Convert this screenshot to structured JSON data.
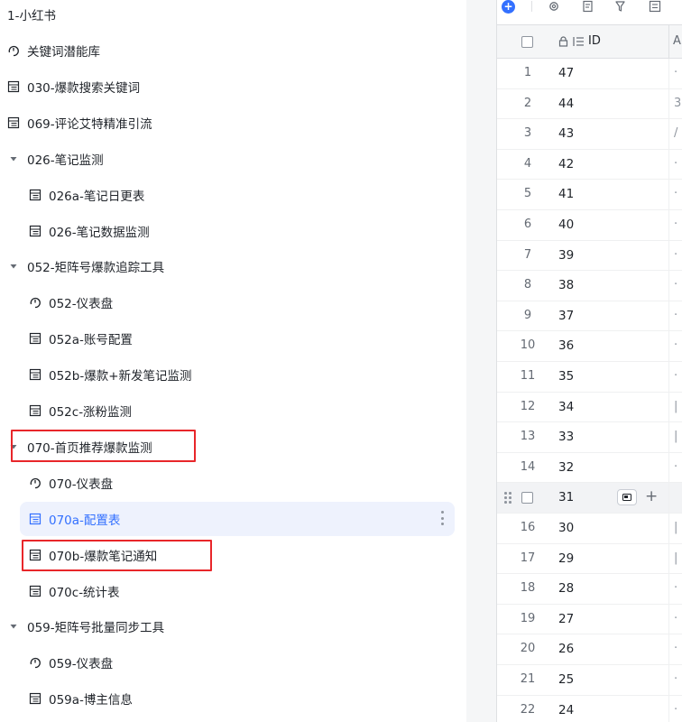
{
  "sidebar": {
    "title": "1-小红书",
    "items": [
      {
        "label": "关键词潜能库",
        "icon": "dashboard-icon"
      },
      {
        "label": "030-爆款搜索关键词",
        "icon": "table-icon"
      },
      {
        "label": "069-评论艾特精准引流",
        "icon": "table-icon"
      },
      {
        "label": "026-笔记监测",
        "icon": "caret-down-icon",
        "expanded": true
      },
      {
        "label": "026a-笔记日更表",
        "icon": "table-icon"
      },
      {
        "label": "026-笔记数据监测",
        "icon": "table-icon"
      },
      {
        "label": "052-矩阵号爆款追踪工具",
        "icon": "caret-down-icon",
        "expanded": true
      },
      {
        "label": "052-仪表盘",
        "icon": "dashboard-icon"
      },
      {
        "label": "052a-账号配置",
        "icon": "table-icon"
      },
      {
        "label": "052b-爆款+新发笔记监测",
        "icon": "table-icon"
      },
      {
        "label": "052c-涨粉监测",
        "icon": "table-icon"
      },
      {
        "label": "070-首页推荐爆款监测",
        "icon": "caret-down-icon",
        "expanded": true
      },
      {
        "label": "070-仪表盘",
        "icon": "dashboard-icon"
      },
      {
        "label": "070a-配置表",
        "icon": "table-icon",
        "selected": true
      },
      {
        "label": "070b-爆款笔记通知",
        "icon": "table-icon"
      },
      {
        "label": "070c-统计表",
        "icon": "table-icon"
      },
      {
        "label": "059-矩阵号批量同步工具",
        "icon": "caret-down-icon",
        "expanded": true
      },
      {
        "label": "059-仪表盘",
        "icon": "dashboard-icon"
      },
      {
        "label": "059a-博主信息",
        "icon": "table-icon"
      }
    ]
  },
  "toolbar": {
    "add_label": "+",
    "icons": [
      "settings-icon",
      "form-icon",
      "filter-icon",
      "list-icon"
    ]
  },
  "grid": {
    "header_id": "ID",
    "header_next": "A",
    "rows": [
      {
        "num": "1",
        "id": "47",
        "next": "·"
      },
      {
        "num": "2",
        "id": "44",
        "next": "3"
      },
      {
        "num": "3",
        "id": "43",
        "next": "/"
      },
      {
        "num": "4",
        "id": "42",
        "next": "·"
      },
      {
        "num": "5",
        "id": "41",
        "next": "·"
      },
      {
        "num": "6",
        "id": "40",
        "next": "·"
      },
      {
        "num": "7",
        "id": "39",
        "next": "·"
      },
      {
        "num": "8",
        "id": "38",
        "next": "·"
      },
      {
        "num": "9",
        "id": "37",
        "next": "·"
      },
      {
        "num": "10",
        "id": "36",
        "next": "·"
      },
      {
        "num": "11",
        "id": "35",
        "next": "·"
      },
      {
        "num": "12",
        "id": "34",
        "next": "|"
      },
      {
        "num": "13",
        "id": "33",
        "next": "|"
      },
      {
        "num": "14",
        "id": "32",
        "next": "·"
      },
      {
        "num": "",
        "id": "31",
        "next": "",
        "hover": true
      },
      {
        "num": "16",
        "id": "30",
        "next": "|"
      },
      {
        "num": "17",
        "id": "29",
        "next": "|"
      },
      {
        "num": "18",
        "id": "28",
        "next": "·"
      },
      {
        "num": "19",
        "id": "27",
        "next": "·"
      },
      {
        "num": "20",
        "id": "26",
        "next": "·"
      },
      {
        "num": "21",
        "id": "25",
        "next": "·"
      },
      {
        "num": "22",
        "id": "24",
        "next": "·"
      }
    ]
  },
  "colors": {
    "accent": "#3370ff",
    "highlight_border": "#e8262a",
    "selected_bg": "#eef2fd"
  }
}
